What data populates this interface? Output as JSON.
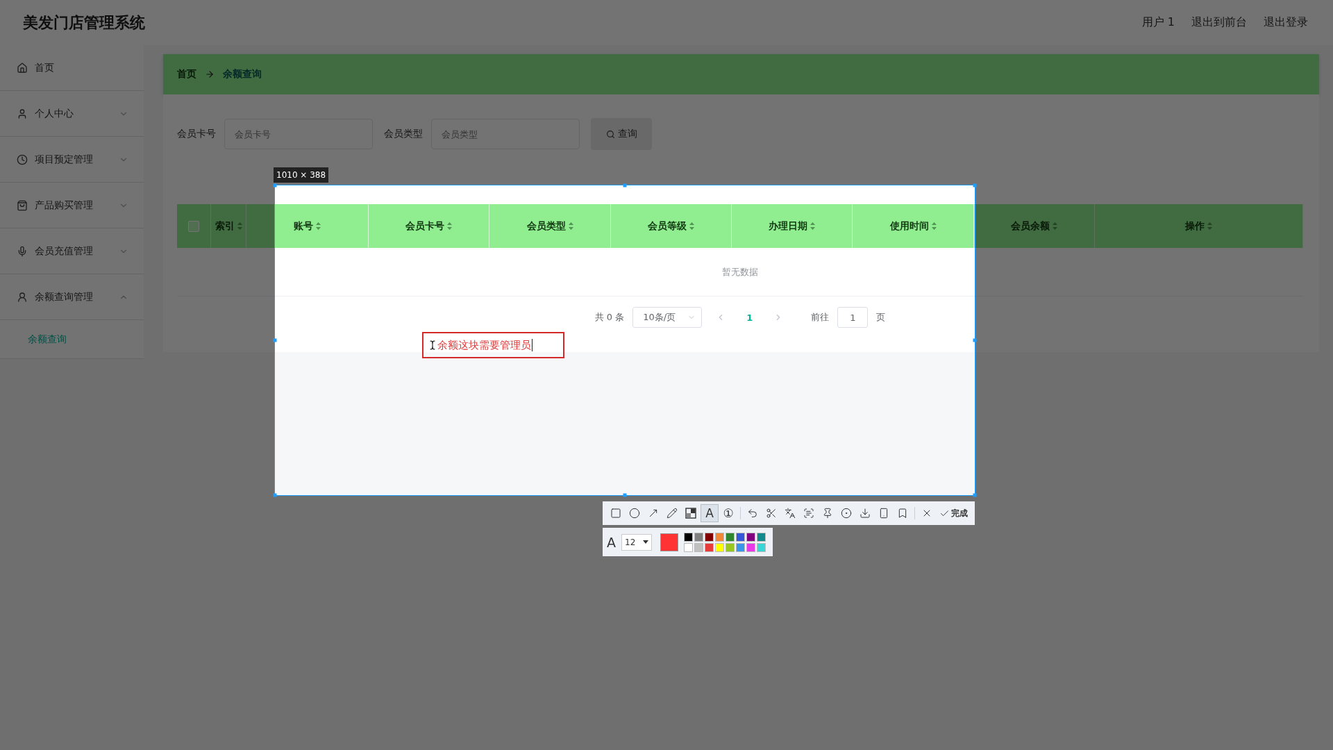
{
  "header": {
    "title": "美发门店管理系统",
    "links": [
      "用户 1",
      "退出到前台",
      "退出登录"
    ]
  },
  "sidebar": {
    "items": [
      {
        "label": "首页"
      },
      {
        "label": "个人中心",
        "expanded": false
      },
      {
        "label": "项目预定管理",
        "expanded": false
      },
      {
        "label": "产品购买管理",
        "expanded": false
      },
      {
        "label": "会员充值管理",
        "expanded": false
      },
      {
        "label": "余额查询管理",
        "expanded": true,
        "children": [
          {
            "label": "余额查询",
            "selected": true
          }
        ]
      }
    ]
  },
  "breadcrumb": [
    "首页",
    "余额查询"
  ],
  "search": {
    "fields": [
      {
        "label": "会员卡号",
        "placeholder": "会员卡号"
      },
      {
        "label": "会员类型",
        "placeholder": "会员类型"
      }
    ],
    "button": "查询"
  },
  "table": {
    "select_all_checked": false,
    "columns": [
      "索引",
      "账号",
      "会员卡号",
      "会员类型",
      "会员等级",
      "办理日期",
      "使用时间",
      "会员余额",
      "操作"
    ],
    "empty_text": "暂无数据"
  },
  "pagination": {
    "total": "共 0 条",
    "page_size": "10条/页",
    "pages": [
      {
        "label": "1",
        "selected": true
      }
    ],
    "goto_label": "前往",
    "goto_value": "1",
    "goto_suffix": "页"
  },
  "capture": {
    "size_label": "1010 × 388",
    "annotation": "余额这块需要管理员",
    "tools": [
      {
        "kind": "rectangle",
        "selected": false
      },
      {
        "kind": "ellipse",
        "selected": false
      },
      {
        "kind": "arrow",
        "selected": false
      },
      {
        "kind": "pencil",
        "selected": false
      },
      {
        "kind": "mosaic",
        "selected": false
      },
      {
        "kind": "text",
        "label": "A",
        "selected": true
      },
      {
        "kind": "number",
        "label": "①",
        "selected": false
      },
      {
        "kind": "separator"
      },
      {
        "kind": "undo",
        "selected": false
      },
      {
        "kind": "cut",
        "selected": false
      },
      {
        "kind": "translate",
        "selected": false
      },
      {
        "kind": "scan",
        "selected": false
      },
      {
        "kind": "pin",
        "selected": false
      },
      {
        "kind": "record",
        "selected": false
      },
      {
        "kind": "download",
        "selected": false
      },
      {
        "kind": "phone",
        "selected": false
      },
      {
        "kind": "bookmark",
        "selected": false
      },
      {
        "kind": "separator"
      },
      {
        "kind": "cancel",
        "selected": false
      },
      {
        "kind": "done",
        "label": "完成",
        "selected": false
      }
    ],
    "font_label": "A",
    "font_size": "12",
    "current_color": {
      "color": "#ff3333"
    },
    "palette": [
      {
        "color": "#000000"
      },
      {
        "color": "#808080"
      },
      {
        "color": "#800000"
      },
      {
        "color": "#f08838"
      },
      {
        "color": "#30862f"
      },
      {
        "color": "#3458d8"
      },
      {
        "color": "#800080"
      },
      {
        "color": "#108a8a"
      },
      {
        "color": "#ffffff"
      },
      {
        "color": "#c0c0c0"
      },
      {
        "color": "#e83c3c"
      },
      {
        "color": "#ffff00"
      },
      {
        "color": "#98c820"
      },
      {
        "color": "#3a96e8"
      },
      {
        "color": "#e838e8"
      },
      {
        "color": "#38d6d6"
      }
    ]
  }
}
